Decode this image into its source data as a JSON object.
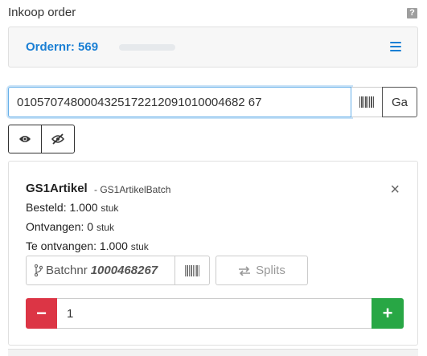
{
  "header": {
    "title": "Inkoop order",
    "help": "?"
  },
  "order": {
    "label": "Ordernr: 569"
  },
  "scan": {
    "value": "0105707480004325172212091010004682 67",
    "go_label": "Ga"
  },
  "article": {
    "name": "GS1Artikel",
    "subtitle": "- GS1ArtikelBatch",
    "besteld_label": "Besteld: 1.000",
    "ontvangen_label": "Ontvangen: 0",
    "te_ontvangen_label": "Te ontvangen: 1.000",
    "unit": "stuk",
    "batch_label": "Batchnr",
    "batch_number": "1000468267",
    "split_label": "Splits",
    "quantity": "1",
    "minus": "−",
    "plus": "+",
    "close": "×"
  },
  "colors": {
    "accent": "#1a7fd4",
    "danger": "#dc3545",
    "success": "#28a745"
  }
}
